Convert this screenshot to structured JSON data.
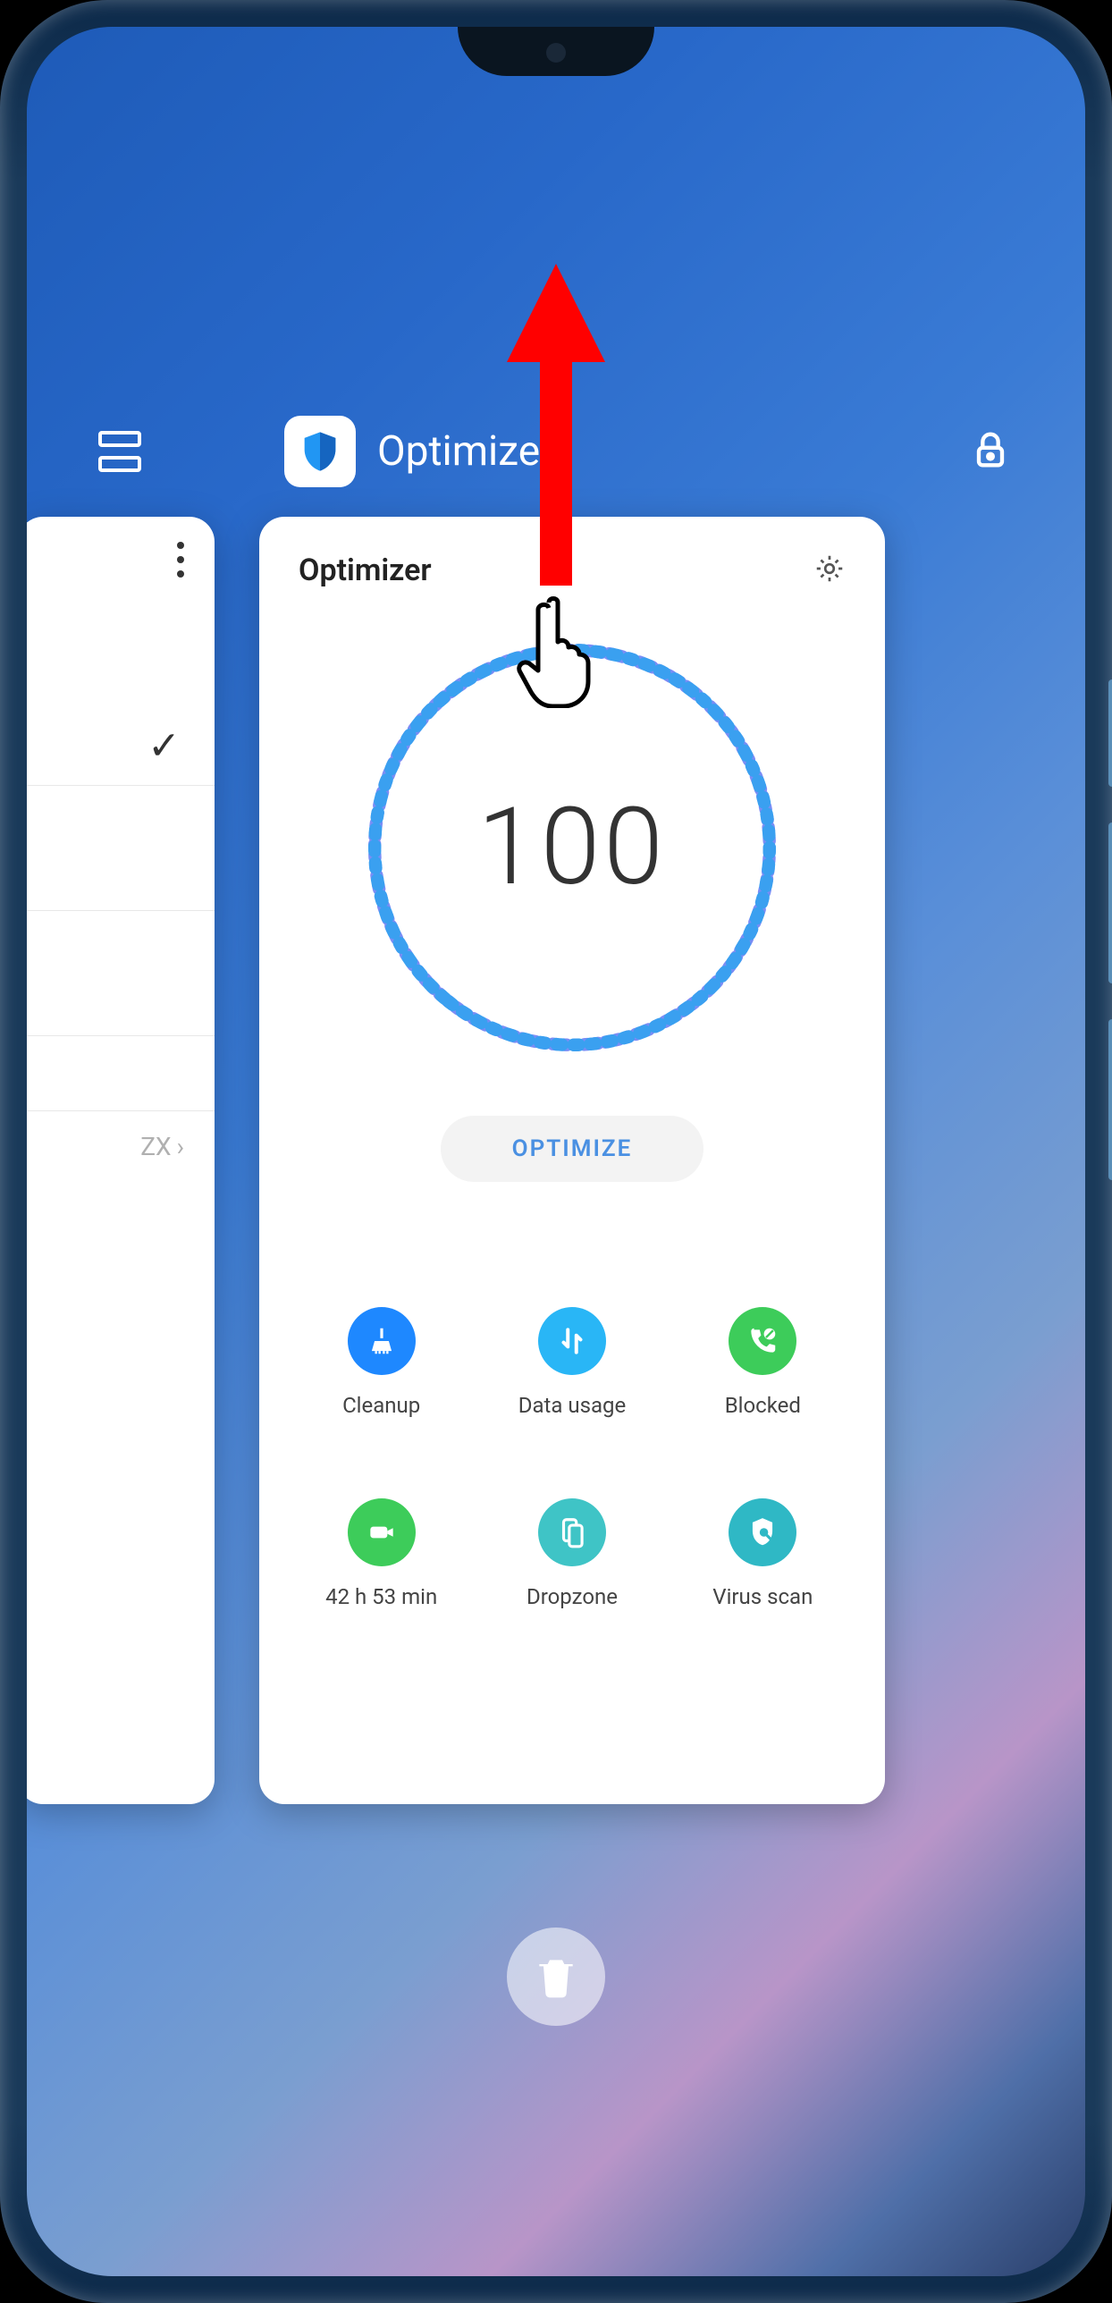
{
  "recent": {
    "app_name": "Optimizer",
    "prev_card_text": "ZX"
  },
  "optimizer": {
    "title": "Optimizer",
    "score": "100",
    "button_label": "OPTIMIZE",
    "tools": [
      {
        "label": "Cleanup"
      },
      {
        "label": "Data usage"
      },
      {
        "label": "Blocked"
      },
      {
        "label": "42 h 53 min"
      },
      {
        "label": "Dropzone"
      },
      {
        "label": "Virus scan"
      }
    ]
  }
}
